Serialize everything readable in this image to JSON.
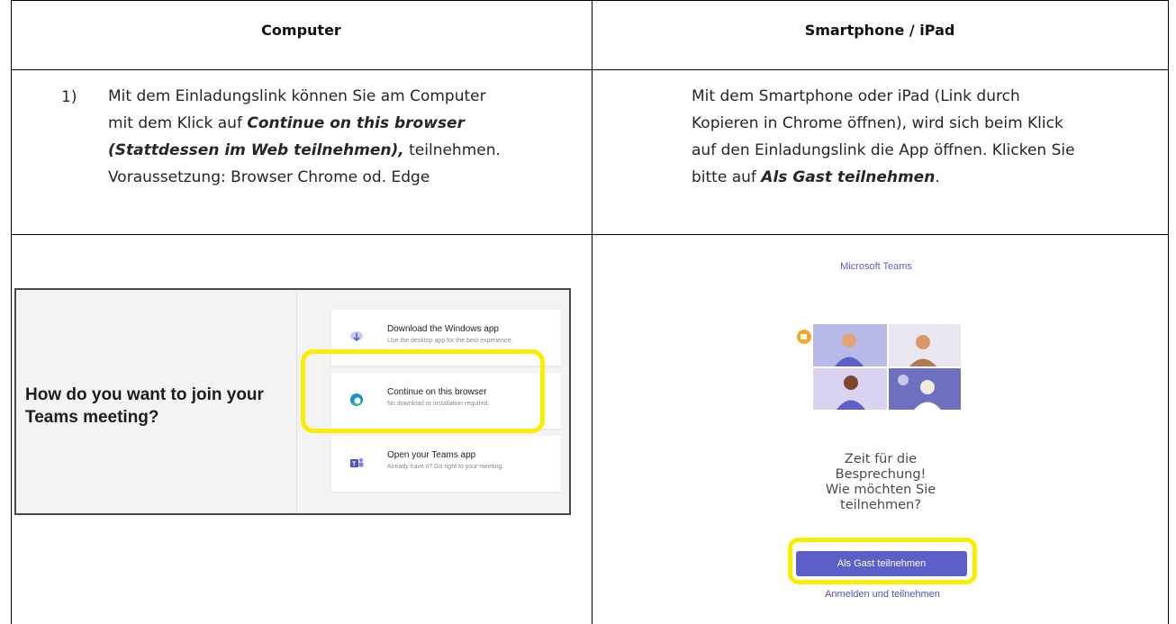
{
  "headers": {
    "left": "Computer",
    "right": "Smartphone / iPad"
  },
  "left_instructions": {
    "number": "1)",
    "line1": "Mit dem Einladungslink können Sie am Computer",
    "line2_prefix": "mit dem Klick auf ",
    "line2_bold": "Continue on this browser",
    "line3_bold": "(Stattdessen im Web teilnehmen),",
    "line3_suffix": " teilnehmen.",
    "line4": "Voraussetzung: Browser Chrome od. Edge"
  },
  "right_instructions": {
    "line1": "Mit dem Smartphone oder iPad  (Link durch",
    "line2": "Kopieren in Chrome öffnen), wird sich beim Klick",
    "line3": "auf den Einladungslink die App öffnen. Klicken Sie",
    "line4_prefix": "bitte auf ",
    "line4_bold": "Als Gast teilnehmen",
    "line4_suffix": "."
  },
  "teams_join_screen": {
    "question": "How do you want to join your Teams meeting?",
    "options": [
      {
        "title": "Download the Windows app",
        "subtitle": "Use the desktop app for the best experience.",
        "icon": "download-icon"
      },
      {
        "title": "Continue on this browser",
        "subtitle": "No download or installation required.",
        "icon": "edge-icon"
      },
      {
        "title": "Open your Teams app",
        "subtitle": "Already have it? Go right to your meeting.",
        "icon": "teams-icon"
      }
    ]
  },
  "phone_screen": {
    "app_name": "Microsoft Teams",
    "prompt_line1": "Zeit für die",
    "prompt_line2": "Besprechung!",
    "prompt_line3": "Wie möchten Sie",
    "prompt_line4": "teilnehmen?",
    "guest_button": "Als Gast teilnehmen",
    "signin_link": "Anmelden und teilnehmen"
  },
  "colors": {
    "teams_purple": "#5b5fc7",
    "highlight_yellow": "#f8ee00"
  }
}
